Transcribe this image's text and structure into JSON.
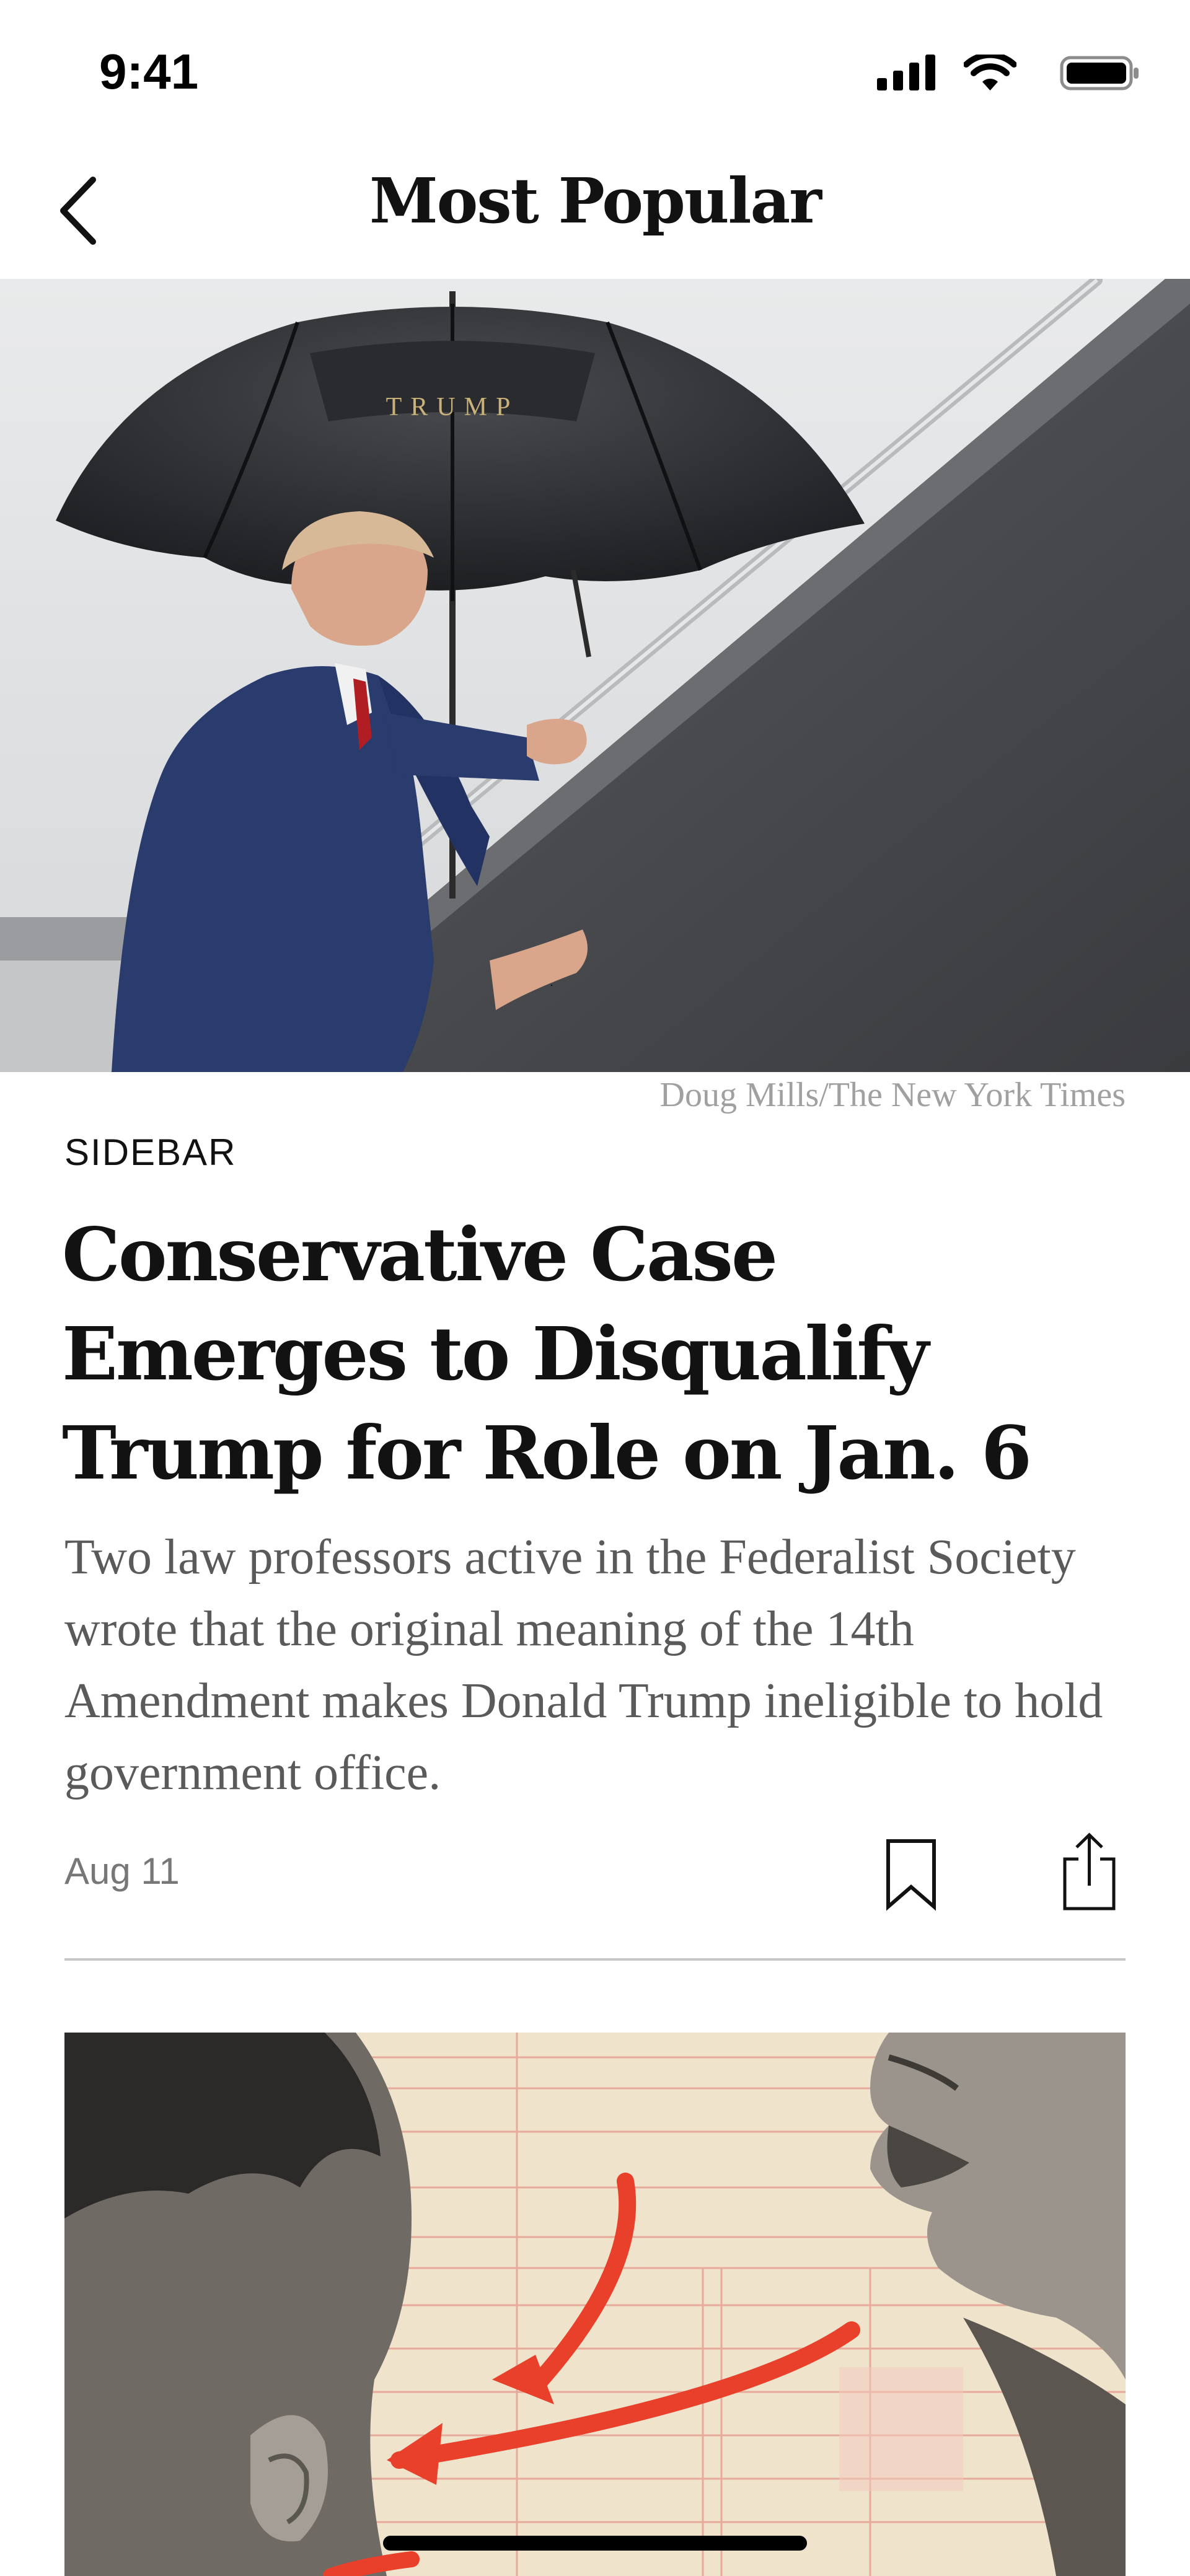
{
  "status_bar": {
    "time": "9:41",
    "icons": [
      "cellular-signal-icon",
      "wifi-icon",
      "battery-icon"
    ]
  },
  "nav": {
    "title": "Most Popular",
    "back_icon": "chevron-left-icon"
  },
  "article": {
    "image_credit": "Doug Mills/The New York Times",
    "umbrella_text": "TRUMP",
    "kicker": "SIDEBAR",
    "headline": "Conservative Case Emerges to Disqualify Trump for Role on Jan. 6",
    "summary": "Two law professors active in the Federalist Society wrote that the original meaning of the 14th Amendment makes Donald Trump ineligible to hold government office.",
    "date": "Aug 11",
    "actions": [
      "bookmark-icon",
      "share-icon"
    ]
  },
  "colors": {
    "text": "#121212",
    "muted": "#5a5a5a",
    "credit": "#a0a0a0",
    "divider": "#c8c8c8",
    "accent_red": "#e8402a",
    "paper": "#efe3cc"
  }
}
